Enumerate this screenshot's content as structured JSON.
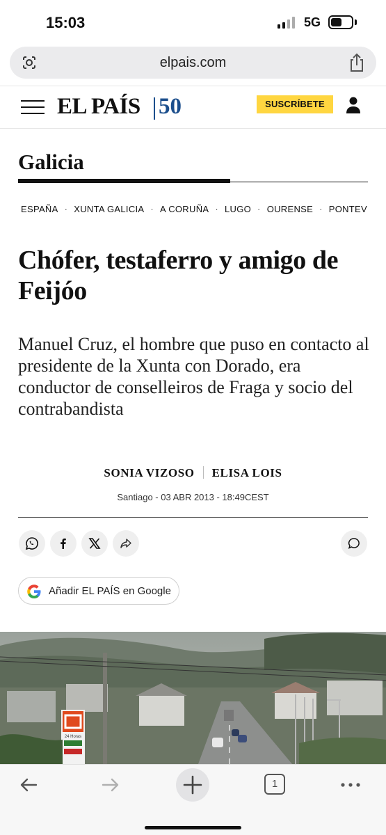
{
  "status": {
    "time": "15:03",
    "network": "5G",
    "battery_level": 0.55
  },
  "browser": {
    "url": "elpais.com",
    "lens_icon": "camera-search-icon",
    "share_icon": "share-icon"
  },
  "site": {
    "logo_text": "EL PAÍS",
    "logo_badge": "50",
    "subscribe_label": "SUSCRÍBETE",
    "brand_blue": "#1b4e8c",
    "accent_yellow": "#ffd640"
  },
  "section": {
    "title": "Galicia",
    "subnav": [
      "ESPAÑA",
      "XUNTA GALICIA",
      "A CORUÑA",
      "LUGO",
      "OURENSE",
      "PONTEVEDRA"
    ]
  },
  "article": {
    "headline": "Chófer, testaferro y amigo de Feijóo",
    "dek": "Manuel Cruz, el hombre que puso en contacto al presidente de la Xunta con Dorado, era conductor de conselleiros de Fraga y socio del contrabandista",
    "authors": [
      "SONIA VIZOSO",
      "ELISA LOIS"
    ],
    "dateline": "Santiago - 03 ABR 2013 - 18:49CEST"
  },
  "share": {
    "buttons": [
      "whatsapp-icon",
      "facebook-icon",
      "x-icon",
      "share-arrow-icon"
    ],
    "comments_icon": "comment-icon",
    "google_label": "Añadir EL PAÍS en Google"
  },
  "photo": {
    "sign_text": "24 Horas"
  },
  "toolbar": {
    "tab_count": "1",
    "icons": [
      "back-arrow-icon",
      "forward-arrow-icon",
      "new-tab-plus-icon",
      "tabs-icon",
      "more-dots-icon"
    ]
  }
}
